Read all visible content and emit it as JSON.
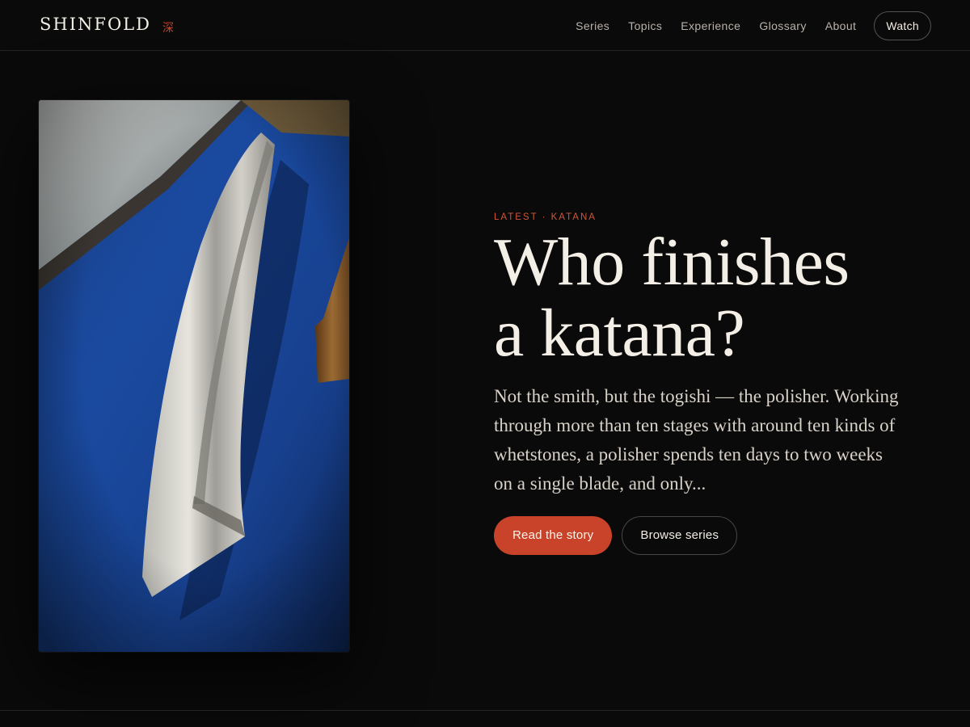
{
  "brand": {
    "name": "SHINFOLD",
    "mark": "深"
  },
  "nav": {
    "items": [
      {
        "label": "Series"
      },
      {
        "label": "Topics"
      },
      {
        "label": "Experience"
      },
      {
        "label": "Glossary"
      },
      {
        "label": "About"
      }
    ],
    "watch_label": "Watch"
  },
  "hero": {
    "eyebrow": "LATEST · KATANA",
    "headline_line1": "Who finishes",
    "headline_line2": "a katana?",
    "lede": "Not the smith, but the togishi — the polisher. Working through more than ten stages with around ten kinds of whetstones, a polisher spends ten days to two weeks on a single blade, and only...",
    "primary_cta": "Read the story",
    "secondary_cta": "Browse series"
  },
  "colors": {
    "background": "#0b0a0a",
    "accent": "#c8432a",
    "text": "#f2ede4"
  }
}
